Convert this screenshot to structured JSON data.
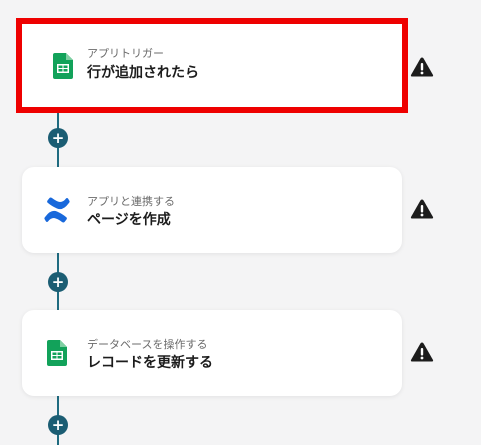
{
  "flow": {
    "steps": [
      {
        "kind": "trigger",
        "subtitle": "アプリトリガー",
        "title": "行が追加されたら",
        "icon": "google-sheets-icon",
        "selected": true,
        "warning_icon": "warning-icon"
      },
      {
        "kind": "action",
        "subtitle": "アプリと連携する",
        "title": "ページを作成",
        "icon": "confluence-icon",
        "selected": false,
        "warning_icon": "warning-icon"
      },
      {
        "kind": "action",
        "subtitle": "データベースを操作する",
        "title": "レコードを更新する",
        "icon": "google-sheets-icon",
        "selected": false,
        "warning_icon": "warning-icon"
      }
    ],
    "add_button_label": "+"
  },
  "colors": {
    "background": "#f4f4f5",
    "selected_border": "#ee0000",
    "connector": "#1f6b80",
    "add_button": "#1b5d73",
    "sheets_green": "#12a25a",
    "confluence_blue": "#1868db"
  }
}
